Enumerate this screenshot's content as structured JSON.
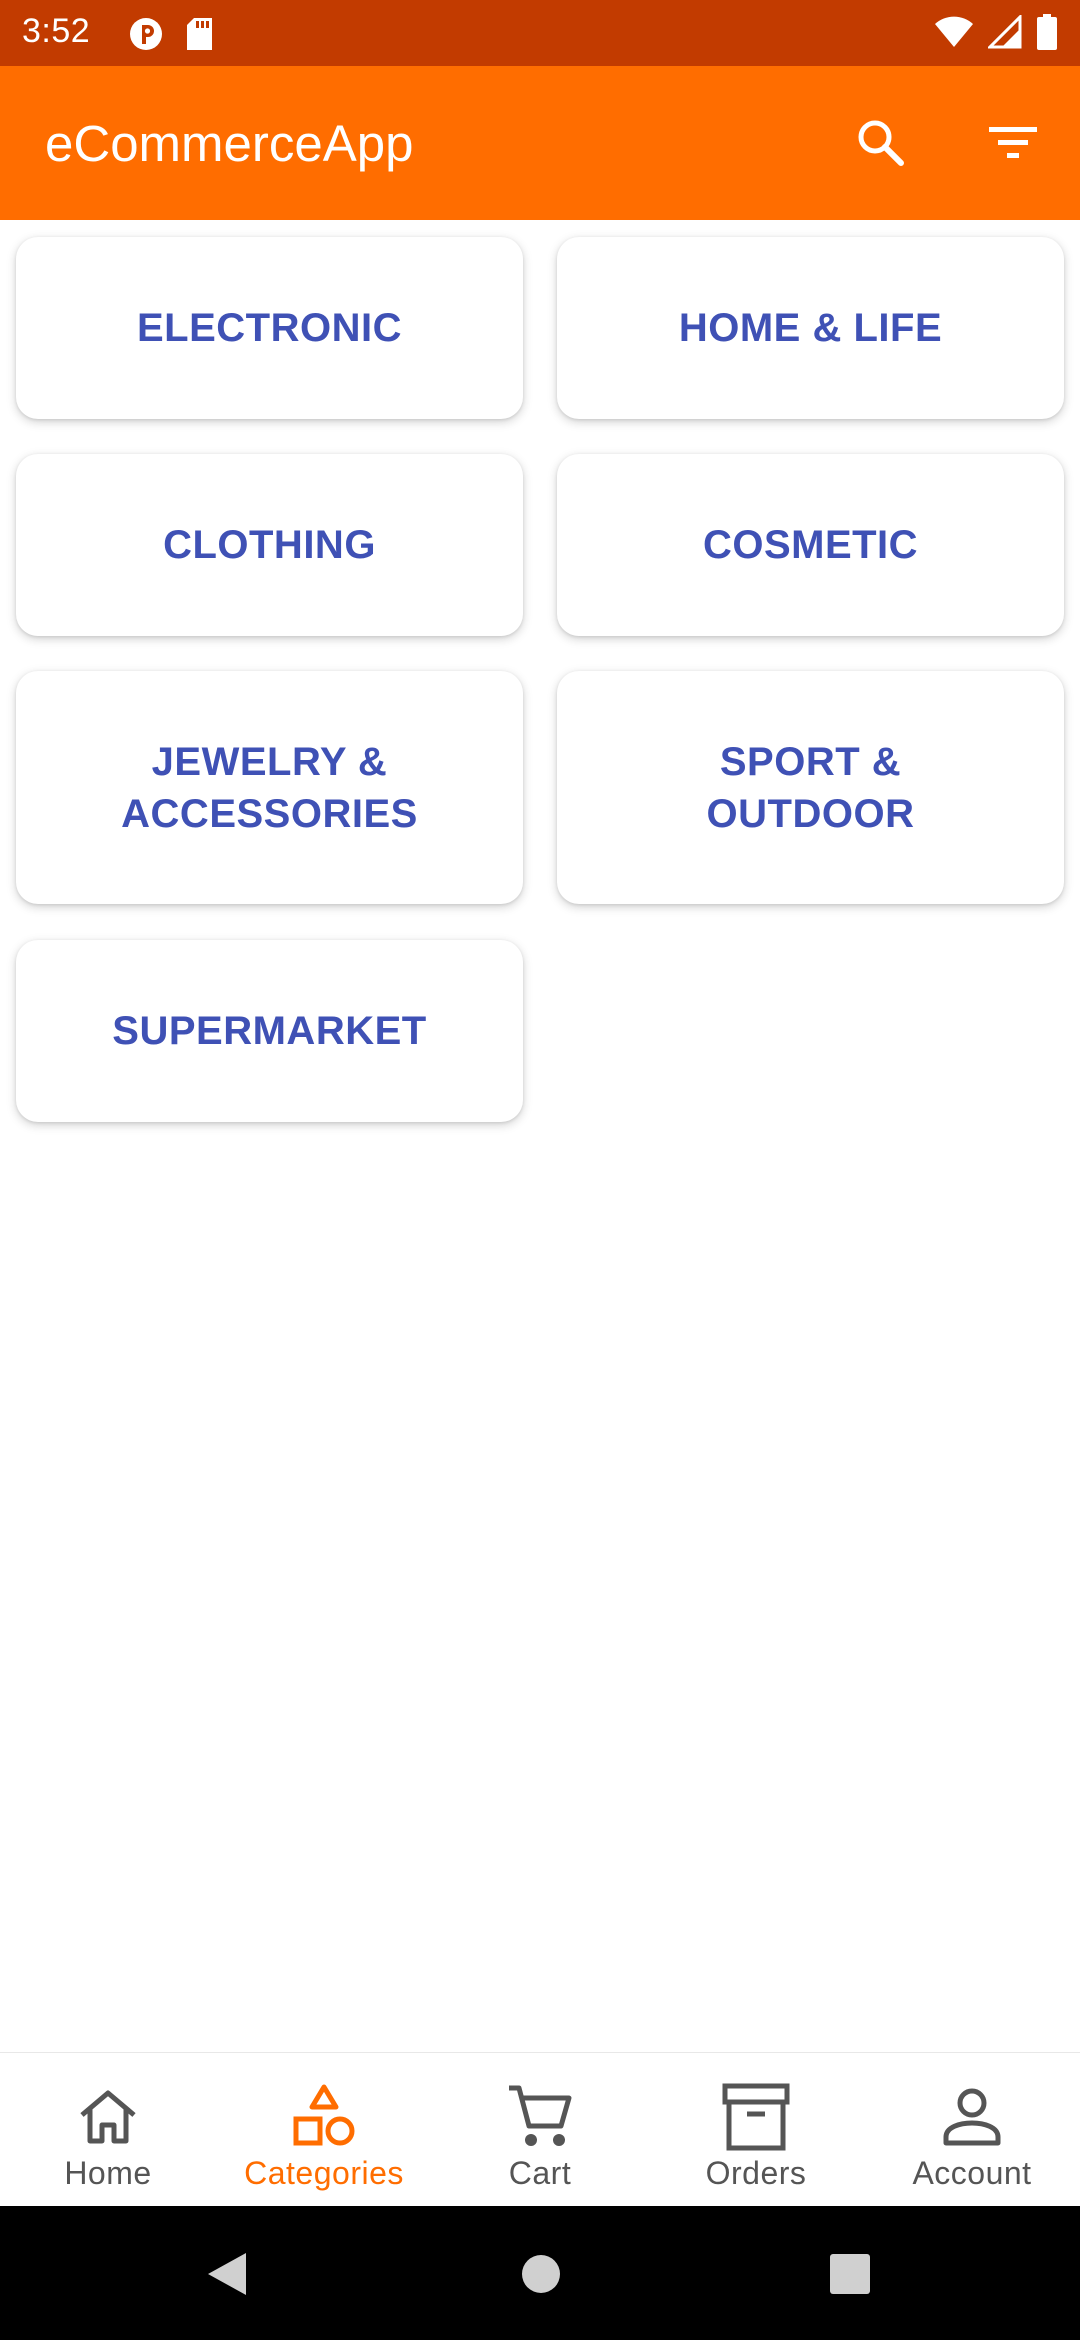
{
  "status_bar": {
    "time": "3:52",
    "icons": [
      "app-notification-icon",
      "sd-card-icon",
      "wifi-icon",
      "signal-icon",
      "battery-icon"
    ]
  },
  "app_bar": {
    "title": "eCommerceApp",
    "actions": [
      "search-icon",
      "filter-icon"
    ]
  },
  "categories": [
    {
      "label": "ELECTRONIC"
    },
    {
      "label": "HOME & LIFE"
    },
    {
      "label": "CLOTHING"
    },
    {
      "label": "COSMETIC"
    },
    {
      "label": "JEWELRY &\nACCESSORIES"
    },
    {
      "label": "SPORT &\nOUTDOOR"
    },
    {
      "label": "SUPERMARKET"
    }
  ],
  "bottom_nav": {
    "active": "Categories",
    "items": [
      {
        "label": "Home",
        "icon": "home-icon"
      },
      {
        "label": "Categories",
        "icon": "categories-icon"
      },
      {
        "label": "Cart",
        "icon": "cart-icon"
      },
      {
        "label": "Orders",
        "icon": "orders-icon"
      },
      {
        "label": "Account",
        "icon": "account-icon"
      }
    ]
  },
  "colors": {
    "status_bar": "#c23b00",
    "app_bar": "#ff6d00",
    "category_text": "#3f51b5",
    "nav_active": "#ff6d00",
    "nav_inactive": "#555555"
  }
}
